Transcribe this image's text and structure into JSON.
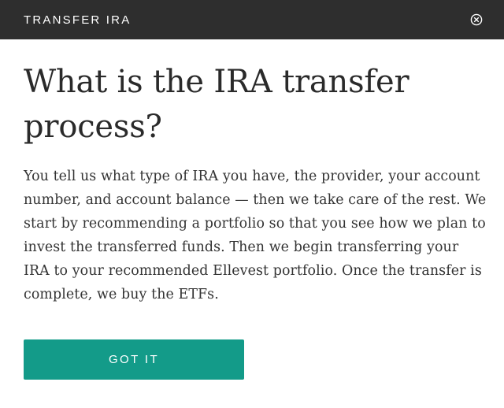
{
  "header": {
    "title": "TRANSFER IRA",
    "close_icon": "close-circle-icon"
  },
  "main": {
    "headline": "What is the IRA transfer process?",
    "body": "You tell us what type of IRA you have, the provider, your account number, and account balance — then we take care of the rest. We start by recommending a portfolio so that you see how we plan to invest the transferred funds. Then we begin transferring your IRA to your recommended Ellevest portfolio. Once the transfer is complete, we buy the ETFs.",
    "button_label": "GOT IT"
  },
  "colors": {
    "header_background": "#2e2e2e",
    "button_background": "#139b89",
    "text": "#2a2a2a"
  }
}
